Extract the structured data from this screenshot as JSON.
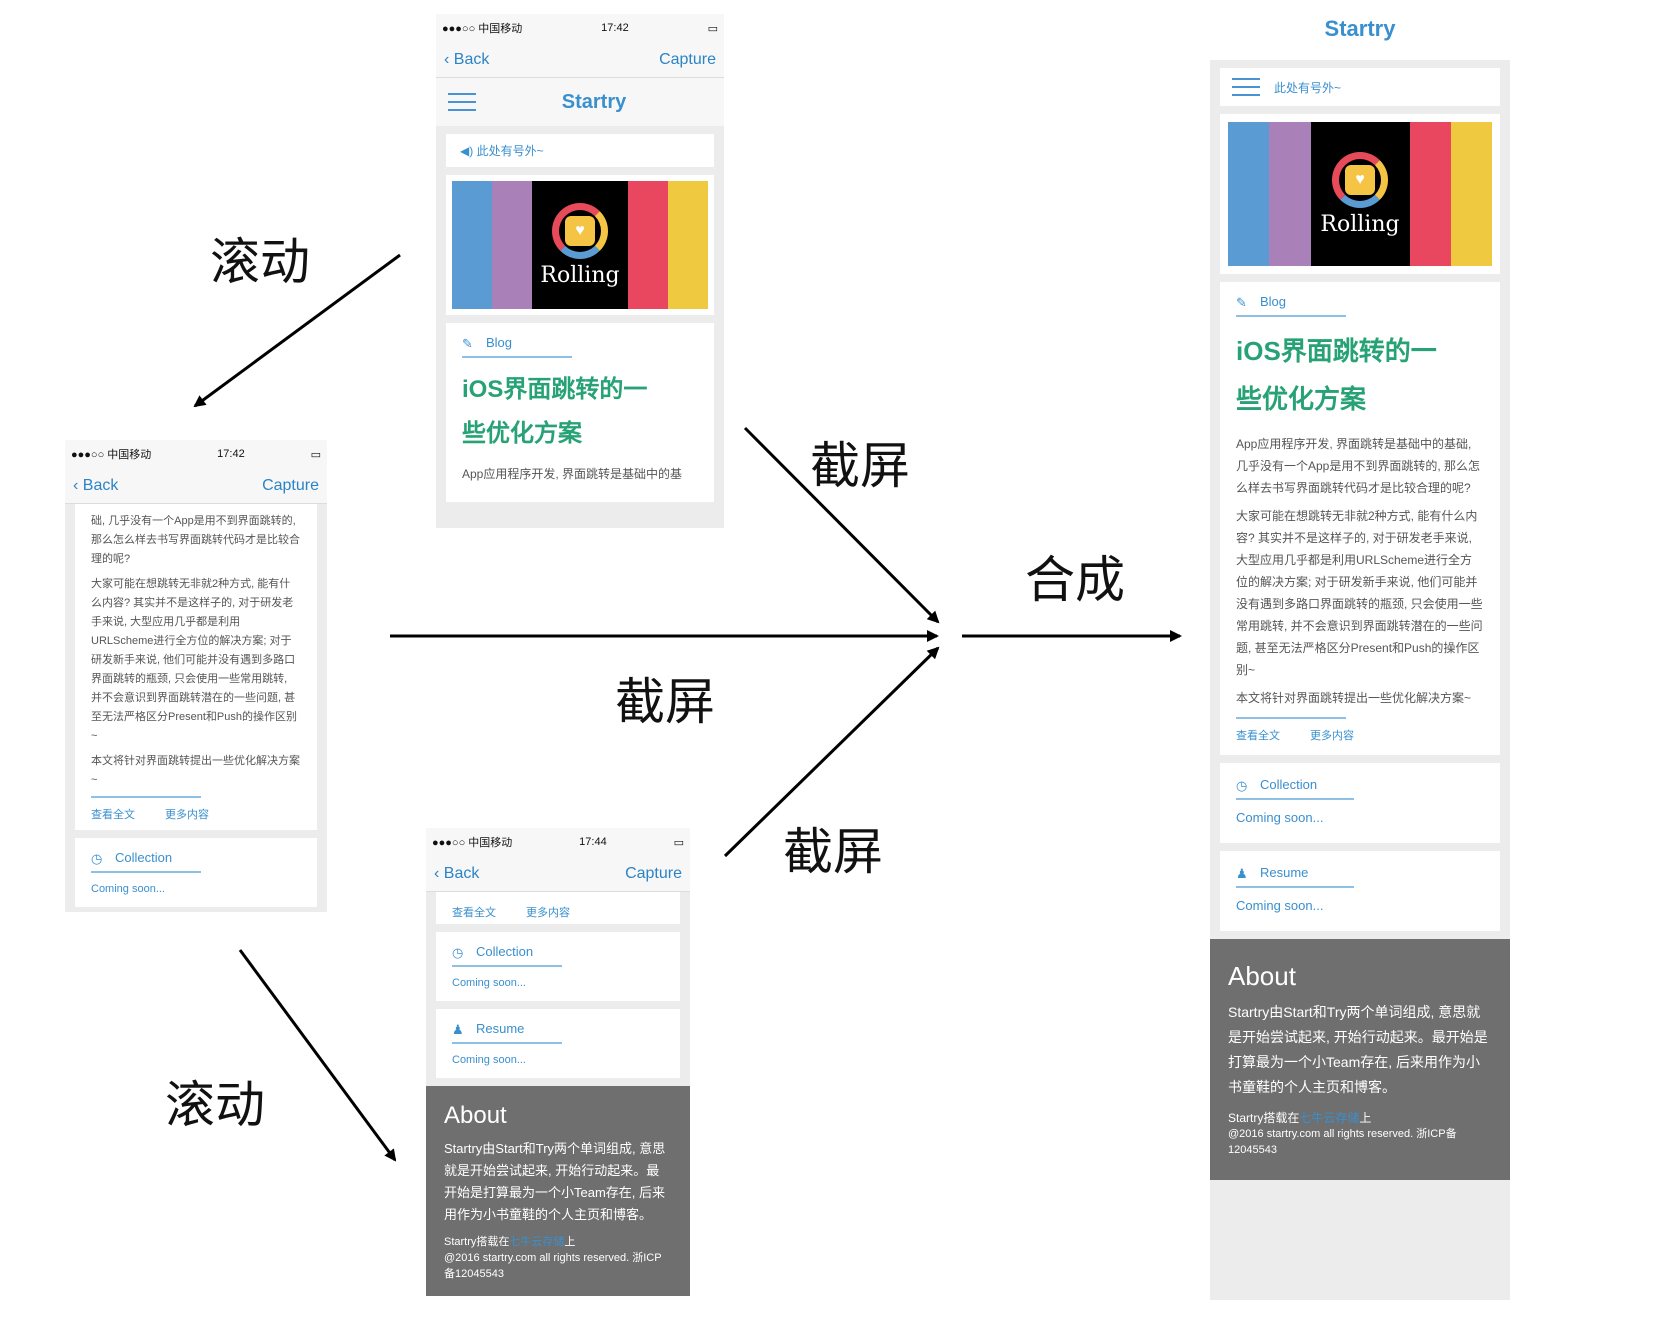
{
  "labels": {
    "scroll": "滚动",
    "screenshot": "截屏",
    "compose": "合成"
  },
  "status": {
    "carrier": "●●●○○ 中国移动",
    "time1": "17:42",
    "time2": "17:44"
  },
  "nav": {
    "back": "Back",
    "capture": "Capture"
  },
  "site": {
    "title": "Startry",
    "notice": "此处有号外~",
    "logo_text": "Rolling"
  },
  "blog": {
    "label": "Blog",
    "title_line1": "iOS界面跳转的一",
    "title_line2": "些优化方案",
    "p1": "App应用程序开发, 界面跳转是基础中的基础, 几乎没有一个App是用不到界面跳转的, 那么怎么样去书写界面跳转代码才是比较合理的呢?",
    "p1_cut": "App应用程序开发, 界面跳转是基础中的基",
    "p1_tail": "础, 几乎没有一个App是用不到界面跳转的, 那么怎么样去书写界面跳转代码才是比较合理的呢?",
    "p2": "大家可能在想跳转无非就2种方式, 能有什么内容? 其实并不是这样子的, 对于研发老手来说, 大型应用几乎都是利用URLScheme进行全方位的解决方案; 对于研发新手来说, 他们可能并没有遇到多路口界面跳转的瓶颈, 只会使用一些常用跳转, 并不会意识到界面跳转潜在的一些问题, 甚至无法严格区分Present和Push的操作区别~",
    "p3": "本文将针对界面跳转提出一些优化解决方案~",
    "read_all": "查看全文",
    "more": "更多内容"
  },
  "collection": {
    "label": "Collection",
    "soon": "Coming soon..."
  },
  "resume": {
    "label": "Resume",
    "soon": "Coming soon..."
  },
  "about": {
    "title": "About",
    "text": "Startry由Start和Try两个单词组成, 意思就是开始尝试起来, 开始行动起来。最开始是打算最为一个小Team存在, 后来用作为小书童鞋的个人主页和博客。",
    "host_prefix": "Startry搭载在",
    "host_link": "七牛云存储",
    "host_suffix": "上",
    "copyright": "@2016 startry.com all rights reserved. 浙ICP备12045543"
  },
  "colors": {
    "accent": "#3a8fce",
    "green": "#27a176",
    "about_bg": "#6f6f6f"
  }
}
